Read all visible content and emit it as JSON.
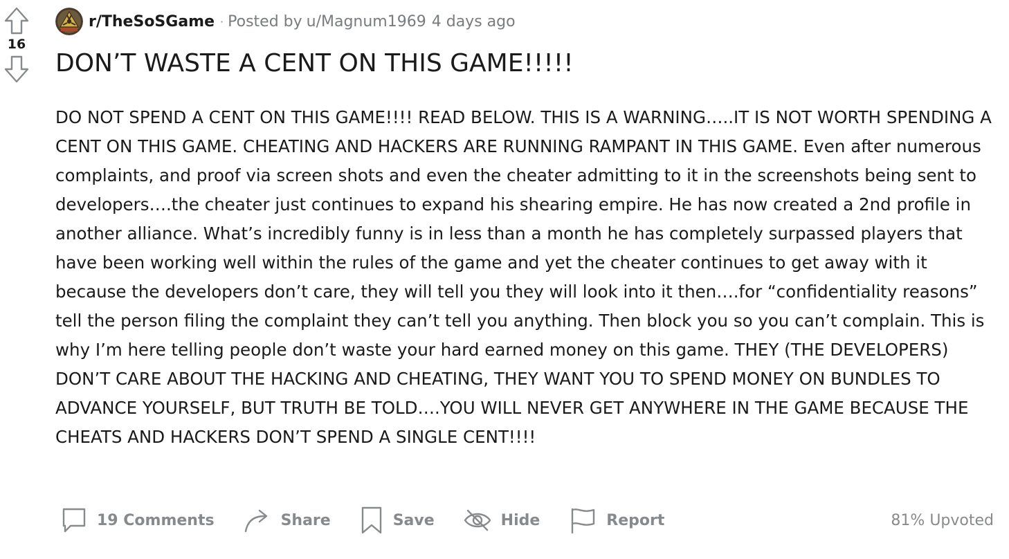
{
  "vote": {
    "count": "16"
  },
  "post": {
    "subreddit": "r/TheSoSGame",
    "separator": "·",
    "posted_by_label": "Posted by",
    "author": "u/Magnum1969",
    "time_ago": "4 days ago",
    "title": "DON’T WASTE A CENT ON THIS GAME!!!!!",
    "body": "DO NOT SPEND A CENT ON THIS GAME!!!! READ BELOW. THIS IS A WARNING…..IT IS NOT WORTH SPENDING A CENT ON THIS GAME. CHEATING AND HACKERS ARE RUNNING RAMPANT IN THIS GAME. Even after numerous complaints, and proof via screen shots and even the cheater admitting to it in the screenshots being sent to developers….the cheater just continues to expand his shearing empire. He has now created a 2nd profile in another alliance. What’s incredibly funny is in less than a month he has completely surpassed players that have been working well within the rules of the game and yet the cheater continues to get away with it because the developers don’t care, they will tell you they will look into it then….for “confidentiality reasons” tell the person filing the complaint they can’t tell you anything. Then block you so you can’t complain. This is why I’m here telling people don’t waste your hard earned money on this game. THEY (THE DEVELOPERS) DON’T CARE ABOUT THE HACKING AND CHEATING, THEY WANT YOU TO SPEND MONEY ON BUNDLES TO ADVANCE YOURSELF, BUT TRUTH BE TOLD….YOU WILL NEVER GET ANYWHERE IN THE GAME BECAUSE THE CHEATS AND HACKERS DON’T SPEND A SINGLE CENT!!!!"
  },
  "actions": {
    "comments": "19 Comments",
    "share": "Share",
    "save": "Save",
    "hide": "Hide",
    "report": "Report",
    "upvoted": "81% Upvoted"
  },
  "icons": {
    "upvote": "arrow-up-icon",
    "downvote": "arrow-down-icon",
    "comments": "comment-bubble-icon",
    "share": "share-arrow-icon",
    "save": "bookmark-icon",
    "hide": "eye-slash-icon",
    "report": "flag-icon"
  },
  "colors": {
    "text": "#1a1a1b",
    "muted": "#787c7e",
    "action": "#878a8c",
    "icon": "#878a8c"
  }
}
